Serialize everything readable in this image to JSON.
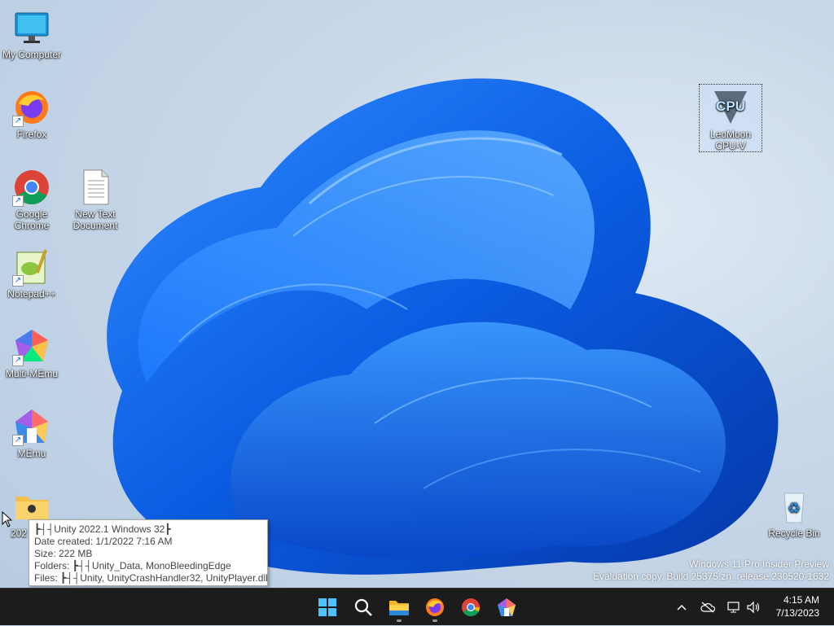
{
  "desktop": {
    "icons": [
      {
        "id": "my-computer",
        "label": "My Computer"
      },
      {
        "id": "firefox",
        "label": "Firefox"
      },
      {
        "id": "google-chrome",
        "label": "Google Chrome"
      },
      {
        "id": "new-text-document",
        "label": "New Text Document"
      },
      {
        "id": "notepad-plus-plus",
        "label": "Notepad++"
      },
      {
        "id": "multi-memu",
        "label": "Multi-MEmu"
      },
      {
        "id": "memu",
        "label": "MEmu"
      },
      {
        "id": "unity-folder",
        "label": "202"
      },
      {
        "id": "leomoon-cpu-v",
        "label": "LeoMoon CPU-V"
      },
      {
        "id": "recycle-bin",
        "label": "Recycle Bin"
      }
    ]
  },
  "tooltip": {
    "title": "┣┤┤Unity 2022.1 Windows 32┣",
    "date_created": "Date created: 1/1/2022 7:16 AM",
    "size": "Size: 222 MB",
    "folders": "Folders: ┣┤┤Unity_Data, MonoBleedingEdge",
    "files": "Files: ┣┤┤Unity, UnityCrashHandler32, UnityPlayer.dll"
  },
  "watermark": {
    "line1": "Windows 11 Pro Insider Preview",
    "line2": "Evaluation copy. Build 25375.zn_release.230520-1632"
  },
  "taskbar": {
    "apps": [
      "start-icon",
      "search-icon",
      "file-explorer-icon",
      "firefox-icon",
      "chrome-icon",
      "memu-icon"
    ],
    "tray_icons": [
      "chevron-up-icon",
      "onedrive-icon",
      "network-icon",
      "volume-icon"
    ],
    "time": "4:15 AM",
    "date": "7/13/2023"
  },
  "colors": {
    "taskbar_bg": "#1c1c1c",
    "accent_blue": "#1a73e8",
    "wallpaper_bg": "#c9d8e9"
  }
}
